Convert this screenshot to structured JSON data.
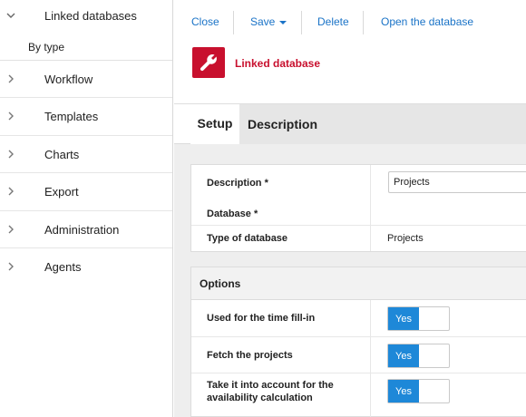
{
  "sidebar": {
    "header": "Linked databases",
    "sub": "By type",
    "items": [
      {
        "label": "Workflow"
      },
      {
        "label": "Templates"
      },
      {
        "label": "Charts"
      },
      {
        "label": "Export"
      },
      {
        "label": "Administration"
      },
      {
        "label": "Agents"
      }
    ]
  },
  "toolbar": {
    "close": "Close",
    "save": "Save",
    "delete": "Delete",
    "open": "Open the database"
  },
  "header": {
    "title": "Linked database",
    "icon": "wrench-icon"
  },
  "tabs": [
    {
      "label": "Setup"
    },
    {
      "label": "Description"
    }
  ],
  "form": {
    "description_label": "Description *",
    "description_value": "Projects",
    "database_label": "Database *",
    "type_label": "Type of database",
    "type_value": "Projects"
  },
  "options": {
    "title": "Options",
    "rows": [
      {
        "label": "Used for the time fill-in",
        "toggle": "Yes"
      },
      {
        "label": "Fetch the projects",
        "toggle": "Yes"
      },
      {
        "label_line1": "Take it into account for the",
        "label_line2": "availability calculation",
        "toggle": "Yes"
      }
    ]
  },
  "colors": {
    "accent": "#1e88d8",
    "brand": "#c8102e",
    "link": "#1a73c7"
  }
}
